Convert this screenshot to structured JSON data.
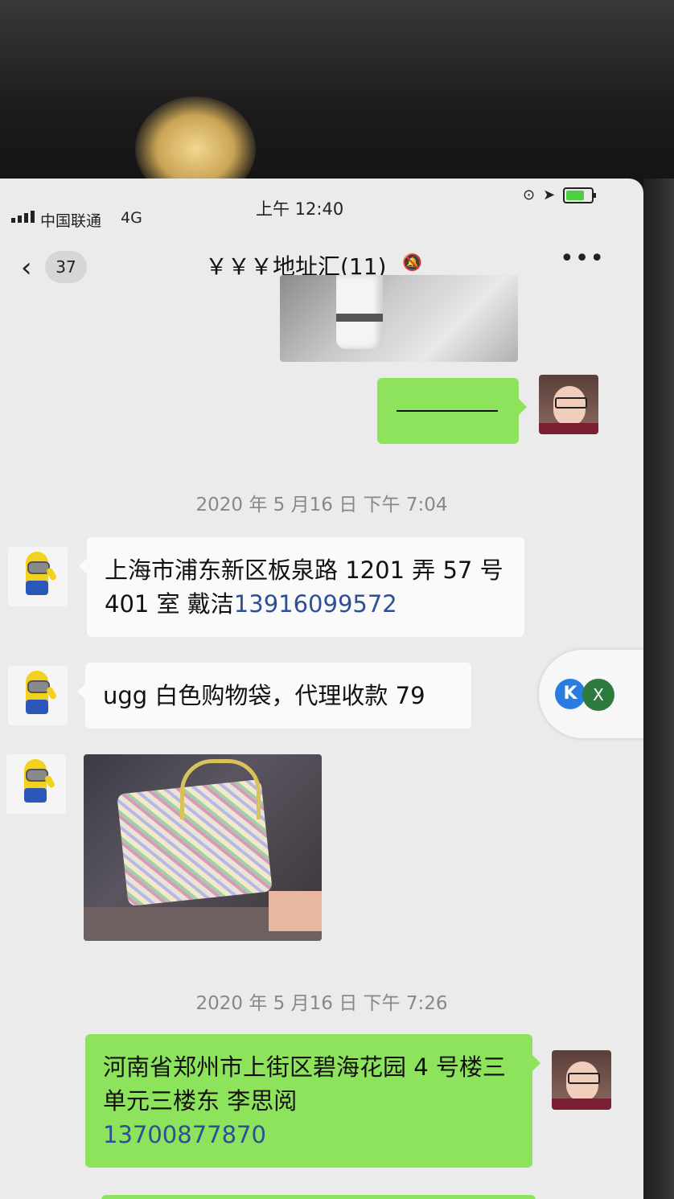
{
  "status_bar": {
    "carrier": "中国联通",
    "network": "4G",
    "time": "上午 12:40"
  },
  "nav": {
    "unread_count": "37",
    "chat_title": "￥￥￥地址汇(11)",
    "more_label": "•••"
  },
  "messages": {
    "ts1": "2020 年 5 月16 日  下午 7:04",
    "ts2": "2020 年 5 月16 日  下午 7:26",
    "msg_addr1_text": "上海市浦东新区板泉路 1201 弄 57 号 401 室  戴洁",
    "msg_addr1_phone": "13916099572",
    "msg_ugg": "ugg 白色购物袋，代理收款 79",
    "msg_addr2_text": "河南省郑州市上街区碧海花园 4 号楼三单元三楼东  李思阅",
    "msg_addr2_phone": "13700877870"
  },
  "floating_widget": {
    "k_label": "K",
    "x_label": "X"
  },
  "icons": {
    "mute": "bell-slash-icon",
    "back": "chevron-left-icon",
    "location": "location-arrow-icon",
    "battery": "battery-charging-icon"
  }
}
